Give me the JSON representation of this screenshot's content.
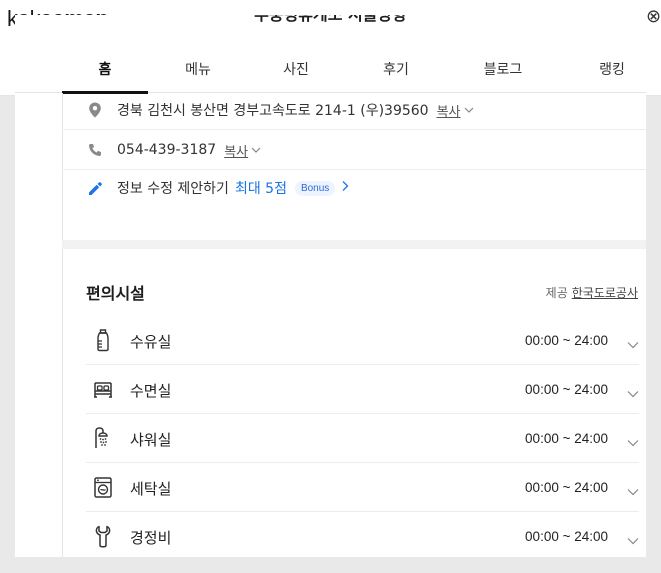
{
  "app": {
    "logo_light": "kakao",
    "logo_bold": "map",
    "close_glyph": "⊗"
  },
  "place": {
    "title": "추풍령휴게소 서울방향"
  },
  "tabs": [
    {
      "label": "홈",
      "active": true
    },
    {
      "label": "메뉴"
    },
    {
      "label": "사진"
    },
    {
      "label": "후기"
    },
    {
      "label": "블로그"
    },
    {
      "label": "랭킹"
    }
  ],
  "info": {
    "address": "경북 김천시 봉산면 경부고속도로 214-1 (우)39560",
    "address_copy": "복사",
    "phone": "054-439-3187",
    "phone_copy": "복사",
    "suggest_text": "정보 수정 제안하기",
    "suggest_link": "최대 5점",
    "bonus_badge": "Bonus"
  },
  "facilities": {
    "title": "편의시설",
    "provider_label": "제공",
    "provider_name": "한국도로공사",
    "items": [
      {
        "icon": "bottle-icon",
        "name": "수유실",
        "hours": "00:00 ~ 24:00"
      },
      {
        "icon": "bed-icon",
        "name": "수면실",
        "hours": "00:00 ~ 24:00"
      },
      {
        "icon": "shower-icon",
        "name": "샤워실",
        "hours": "00:00 ~ 24:00"
      },
      {
        "icon": "washing-machine-icon",
        "name": "세탁실",
        "hours": "00:00 ~ 24:00"
      },
      {
        "icon": "wrench-icon",
        "name": "경정비",
        "hours": "00:00 ~ 24:00"
      }
    ]
  },
  "colors": {
    "accent_blue": "#1a73e8",
    "bonus_bg": "#edf3ff",
    "text": "#222222"
  }
}
